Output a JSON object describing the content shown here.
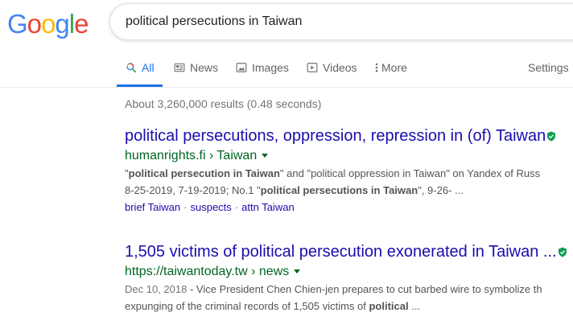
{
  "logo": {
    "letters": [
      "G",
      "o",
      "o",
      "g",
      "l",
      "e"
    ],
    "colors": [
      "#4285F4",
      "#EA4335",
      "#FBBC05",
      "#4285F4",
      "#34A853",
      "#EA4335"
    ]
  },
  "search": {
    "query": "political persecutions in Taiwan"
  },
  "tabs": [
    {
      "label": "All",
      "icon": "search-icon",
      "active": true
    },
    {
      "label": "News",
      "icon": "news-icon"
    },
    {
      "label": "Images",
      "icon": "image-icon"
    },
    {
      "label": "Videos",
      "icon": "video-icon"
    },
    {
      "label": "More",
      "icon": "more-vert-icon"
    }
  ],
  "settings_label": "Settings",
  "stats": "About 3,260,000 results (0.48 seconds)",
  "results": [
    {
      "title": "political persecutions, oppression, repression in (of) Taiwan",
      "url": "humanrights.fi › Taiwan",
      "snippet1": [
        {
          "t": "\"",
          "b": false
        },
        {
          "t": "political persecution in Taiwan",
          "b": true
        },
        {
          "t": "\" and \"political oppression in Taiwan\" on Yandex of Russ",
          "b": false
        }
      ],
      "snippet2": [
        {
          "t": "8-25-2019, 7-19-2019; No.1 \"",
          "b": false
        },
        {
          "t": "political persecutions in Taiwan",
          "b": true
        },
        {
          "t": "\", 9-26- ...",
          "b": false
        }
      ],
      "sitelinks": [
        "brief Taiwan",
        "suspects",
        "attn Taiwan"
      ]
    },
    {
      "title": "1,505 victims of political persecution exonerated in Taiwan ...",
      "url": "https://taiwantoday.tw › news",
      "date": "Dec 10, 2018",
      "snippet1_rest": " - Vice President Chen Chien-jen prepares to cut barbed wire to symbolize th",
      "snippet2": [
        {
          "t": "expunging of the criminal records of 1,505 victims of ",
          "b": false
        },
        {
          "t": "political",
          "b": true
        },
        {
          "t": " ...",
          "b": false
        }
      ]
    }
  ]
}
